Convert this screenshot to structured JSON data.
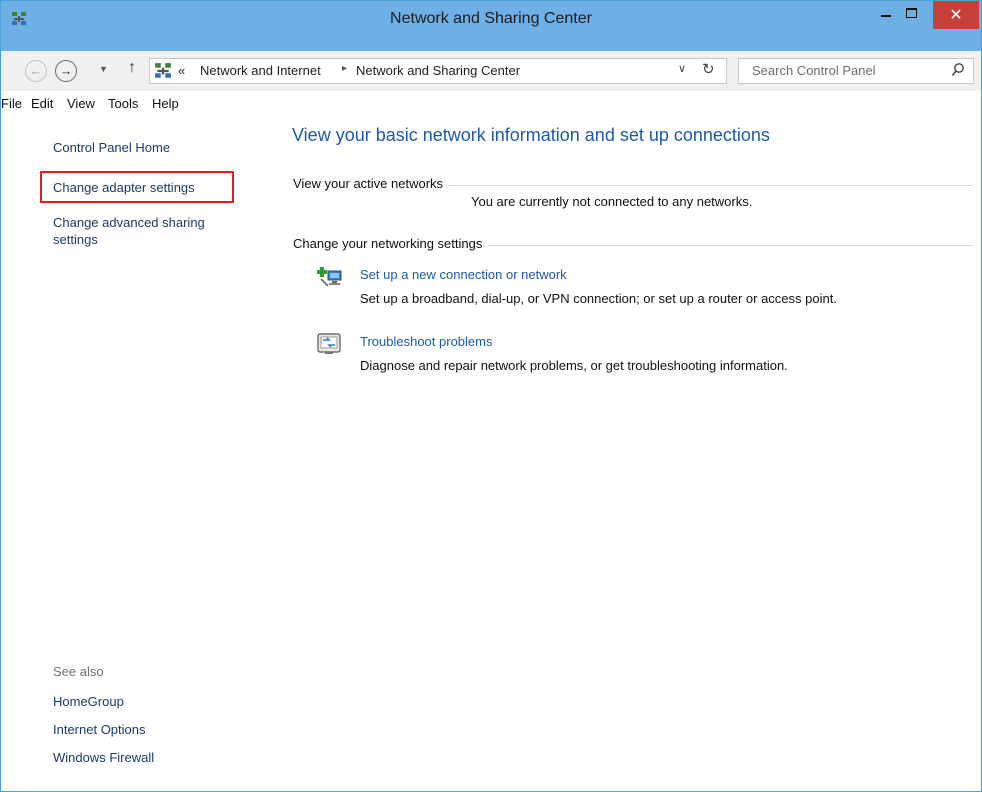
{
  "window": {
    "title": "Network and Sharing Center",
    "close_glyph": "✕",
    "accent": "#6eb0e6",
    "close_color": "#c7413a"
  },
  "nav": {
    "back_glyph": "←",
    "forward_glyph": "→",
    "recent_glyph": "▼",
    "up_glyph": "↑",
    "overflow_glyph": "«",
    "breadcrumb": [
      "Network and Internet",
      "Network and Sharing Center"
    ],
    "breadcrumb_sep": "▸",
    "dropdown_glyph": "∨",
    "refresh_glyph": "↻",
    "search_placeholder": "Search Control Panel"
  },
  "menu": [
    "File",
    "Edit",
    "View",
    "Tools",
    "Help"
  ],
  "left": {
    "home": "Control Panel Home",
    "adapter": "Change adapter settings",
    "sharing_line1": "Change advanced sharing",
    "sharing_line2": "settings",
    "see_also": "See also",
    "homegroup": "HomeGroup",
    "internet_options": "Internet Options",
    "firewall": "Windows Firewall"
  },
  "main": {
    "title": "View your basic network information and set up connections",
    "active_networks": "View your active networks",
    "not_connected": "You are currently not connected to any networks.",
    "change_settings": "Change your networking settings",
    "tasks": [
      {
        "icon": "network-setup-icon",
        "link": "Set up a new connection or network",
        "desc": "Set up a broadband, dial-up, or VPN connection; or set up a router or access point."
      },
      {
        "icon": "troubleshoot-icon",
        "link": "Troubleshoot problems",
        "desc": "Diagnose and repair network problems, or get troubleshooting information."
      }
    ],
    "link_color": "#1e5aa8"
  }
}
